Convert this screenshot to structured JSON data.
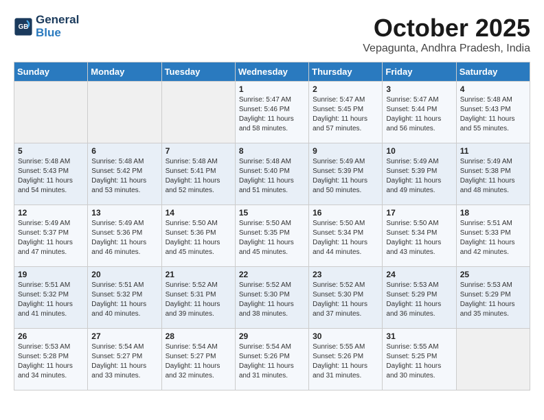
{
  "header": {
    "logo_line1": "General",
    "logo_line2": "Blue",
    "title": "October 2025",
    "subtitle": "Vepagunta, Andhra Pradesh, India"
  },
  "days_of_week": [
    "Sunday",
    "Monday",
    "Tuesday",
    "Wednesday",
    "Thursday",
    "Friday",
    "Saturday"
  ],
  "weeks": [
    [
      {
        "day": "",
        "text": ""
      },
      {
        "day": "",
        "text": ""
      },
      {
        "day": "",
        "text": ""
      },
      {
        "day": "1",
        "text": "Sunrise: 5:47 AM\nSunset: 5:46 PM\nDaylight: 11 hours\nand 58 minutes."
      },
      {
        "day": "2",
        "text": "Sunrise: 5:47 AM\nSunset: 5:45 PM\nDaylight: 11 hours\nand 57 minutes."
      },
      {
        "day": "3",
        "text": "Sunrise: 5:47 AM\nSunset: 5:44 PM\nDaylight: 11 hours\nand 56 minutes."
      },
      {
        "day": "4",
        "text": "Sunrise: 5:48 AM\nSunset: 5:43 PM\nDaylight: 11 hours\nand 55 minutes."
      }
    ],
    [
      {
        "day": "5",
        "text": "Sunrise: 5:48 AM\nSunset: 5:43 PM\nDaylight: 11 hours\nand 54 minutes."
      },
      {
        "day": "6",
        "text": "Sunrise: 5:48 AM\nSunset: 5:42 PM\nDaylight: 11 hours\nand 53 minutes."
      },
      {
        "day": "7",
        "text": "Sunrise: 5:48 AM\nSunset: 5:41 PM\nDaylight: 11 hours\nand 52 minutes."
      },
      {
        "day": "8",
        "text": "Sunrise: 5:48 AM\nSunset: 5:40 PM\nDaylight: 11 hours\nand 51 minutes."
      },
      {
        "day": "9",
        "text": "Sunrise: 5:49 AM\nSunset: 5:39 PM\nDaylight: 11 hours\nand 50 minutes."
      },
      {
        "day": "10",
        "text": "Sunrise: 5:49 AM\nSunset: 5:39 PM\nDaylight: 11 hours\nand 49 minutes."
      },
      {
        "day": "11",
        "text": "Sunrise: 5:49 AM\nSunset: 5:38 PM\nDaylight: 11 hours\nand 48 minutes."
      }
    ],
    [
      {
        "day": "12",
        "text": "Sunrise: 5:49 AM\nSunset: 5:37 PM\nDaylight: 11 hours\nand 47 minutes."
      },
      {
        "day": "13",
        "text": "Sunrise: 5:49 AM\nSunset: 5:36 PM\nDaylight: 11 hours\nand 46 minutes."
      },
      {
        "day": "14",
        "text": "Sunrise: 5:50 AM\nSunset: 5:36 PM\nDaylight: 11 hours\nand 45 minutes."
      },
      {
        "day": "15",
        "text": "Sunrise: 5:50 AM\nSunset: 5:35 PM\nDaylight: 11 hours\nand 45 minutes."
      },
      {
        "day": "16",
        "text": "Sunrise: 5:50 AM\nSunset: 5:34 PM\nDaylight: 11 hours\nand 44 minutes."
      },
      {
        "day": "17",
        "text": "Sunrise: 5:50 AM\nSunset: 5:34 PM\nDaylight: 11 hours\nand 43 minutes."
      },
      {
        "day": "18",
        "text": "Sunrise: 5:51 AM\nSunset: 5:33 PM\nDaylight: 11 hours\nand 42 minutes."
      }
    ],
    [
      {
        "day": "19",
        "text": "Sunrise: 5:51 AM\nSunset: 5:32 PM\nDaylight: 11 hours\nand 41 minutes."
      },
      {
        "day": "20",
        "text": "Sunrise: 5:51 AM\nSunset: 5:32 PM\nDaylight: 11 hours\nand 40 minutes."
      },
      {
        "day": "21",
        "text": "Sunrise: 5:52 AM\nSunset: 5:31 PM\nDaylight: 11 hours\nand 39 minutes."
      },
      {
        "day": "22",
        "text": "Sunrise: 5:52 AM\nSunset: 5:30 PM\nDaylight: 11 hours\nand 38 minutes."
      },
      {
        "day": "23",
        "text": "Sunrise: 5:52 AM\nSunset: 5:30 PM\nDaylight: 11 hours\nand 37 minutes."
      },
      {
        "day": "24",
        "text": "Sunrise: 5:53 AM\nSunset: 5:29 PM\nDaylight: 11 hours\nand 36 minutes."
      },
      {
        "day": "25",
        "text": "Sunrise: 5:53 AM\nSunset: 5:29 PM\nDaylight: 11 hours\nand 35 minutes."
      }
    ],
    [
      {
        "day": "26",
        "text": "Sunrise: 5:53 AM\nSunset: 5:28 PM\nDaylight: 11 hours\nand 34 minutes."
      },
      {
        "day": "27",
        "text": "Sunrise: 5:54 AM\nSunset: 5:27 PM\nDaylight: 11 hours\nand 33 minutes."
      },
      {
        "day": "28",
        "text": "Sunrise: 5:54 AM\nSunset: 5:27 PM\nDaylight: 11 hours\nand 32 minutes."
      },
      {
        "day": "29",
        "text": "Sunrise: 5:54 AM\nSunset: 5:26 PM\nDaylight: 11 hours\nand 31 minutes."
      },
      {
        "day": "30",
        "text": "Sunrise: 5:55 AM\nSunset: 5:26 PM\nDaylight: 11 hours\nand 31 minutes."
      },
      {
        "day": "31",
        "text": "Sunrise: 5:55 AM\nSunset: 5:25 PM\nDaylight: 11 hours\nand 30 minutes."
      },
      {
        "day": "",
        "text": ""
      }
    ]
  ]
}
